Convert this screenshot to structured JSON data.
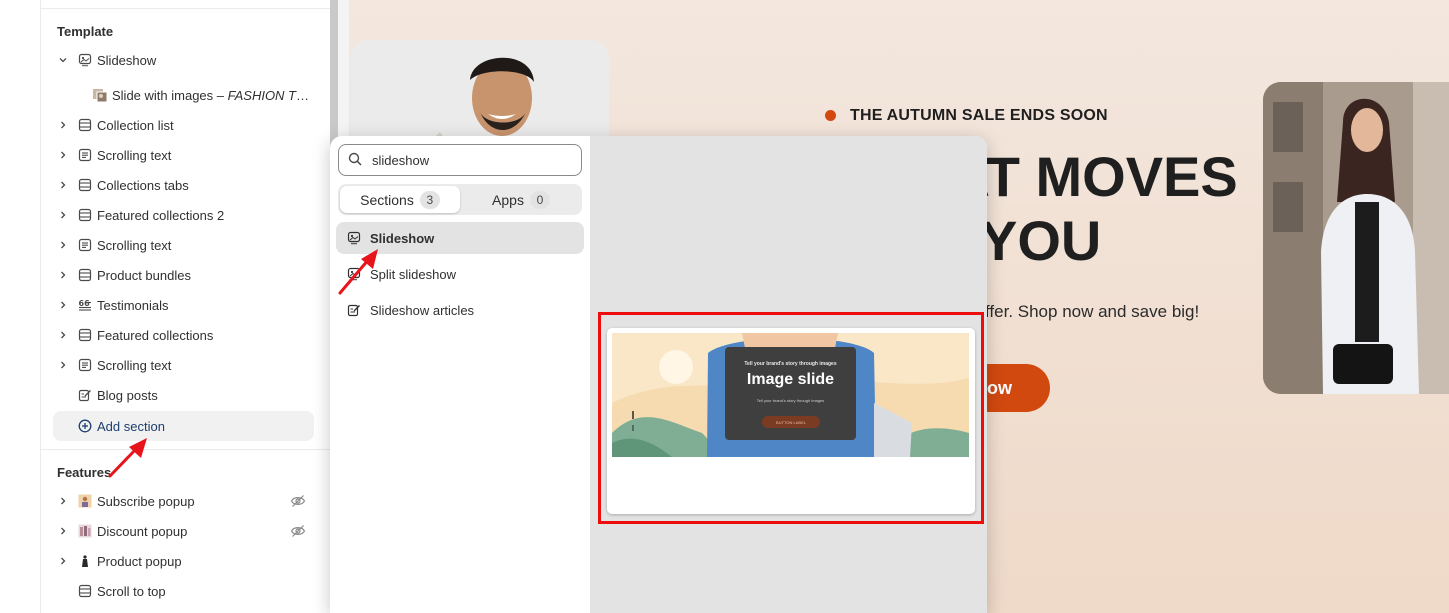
{
  "sidebar": {
    "template_group": "Template",
    "features_group": "Features",
    "items": [
      {
        "label": "Slideshow"
      },
      {
        "label": "Slide with images",
        "sub": "FASHION TH..."
      },
      {
        "label": "Collection list"
      },
      {
        "label": "Scrolling text"
      },
      {
        "label": "Collections tabs"
      },
      {
        "label": "Featured collections 2"
      },
      {
        "label": "Scrolling text"
      },
      {
        "label": "Product bundles"
      },
      {
        "label": "Testimonials"
      },
      {
        "label": "Featured collections"
      },
      {
        "label": "Scrolling text"
      },
      {
        "label": "Blog posts"
      }
    ],
    "add_section": "Add section",
    "features": [
      {
        "label": "Subscribe popup"
      },
      {
        "label": "Discount popup"
      },
      {
        "label": "Product popup"
      },
      {
        "label": "Scroll to top"
      }
    ]
  },
  "picker": {
    "search_value": "slideshow",
    "tabs": [
      {
        "label": "Sections",
        "count": "3"
      },
      {
        "label": "Apps",
        "count": "0"
      }
    ],
    "results": [
      {
        "label": "Slideshow"
      },
      {
        "label": "Split slideshow"
      },
      {
        "label": "Slideshow articles"
      }
    ],
    "preview": {
      "eyebrow": "Tell your brand's story through images",
      "title": "Image slide",
      "desc": "Tell your brand's story through images",
      "button": "BUTTON LABEL"
    }
  },
  "hero": {
    "sale_text": "THE AUTUMN SALE ENDS SOON",
    "title_line1": "HAT MOVES",
    "title_line2": "YOU",
    "sub": "ffer. Shop now and save big!",
    "button": "ow"
  },
  "colors": {
    "accent": "#d2490f",
    "highlight_frame": "#ee0d0d",
    "annotation_arrow": "#e8141b"
  },
  "icons": {
    "search": "search-icon",
    "slideshow": "slideshow-icon",
    "blog": "blog-icon",
    "add": "plus-circle-icon",
    "hidden": "eye-off-icon"
  }
}
